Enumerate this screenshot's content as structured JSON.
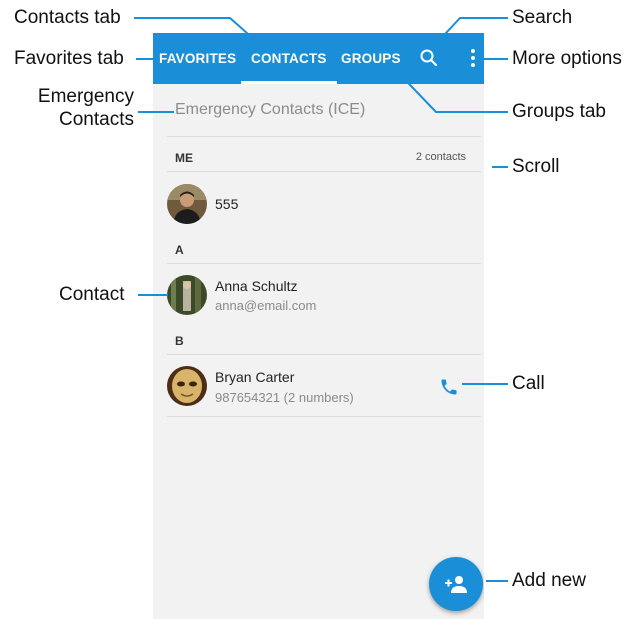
{
  "callouts": {
    "contacts_tab": "Contacts tab",
    "favorites_tab": "Favorites tab",
    "emergency_line1": "Emergency",
    "emergency_line2": "Contacts",
    "contact": "Contact",
    "search": "Search",
    "more_options": "More options",
    "groups_tab": "Groups tab",
    "scroll": "Scroll",
    "call": "Call",
    "add_new": "Add new"
  },
  "appbar": {
    "tabs": [
      "FAVORITES",
      "CONTACTS",
      "GROUPS"
    ],
    "active_tab": "CONTACTS",
    "icons": [
      "search-icon",
      "more-options-icon"
    ],
    "color": "#1a8fd8"
  },
  "ice": {
    "label": "Emergency Contacts (ICE)"
  },
  "sections": {
    "me": {
      "label": "ME",
      "count": "2 contacts"
    },
    "a": {
      "label": "A"
    },
    "b": {
      "label": "B"
    }
  },
  "contacts": [
    {
      "name": "555",
      "sub": ""
    },
    {
      "name": "Anna Schultz",
      "sub": "anna@email.com"
    },
    {
      "name": "Bryan Carter",
      "sub": "987654321 (2 numbers)"
    }
  ],
  "actions": {
    "call_icon": "phone-icon",
    "fab_icon": "add-person-icon"
  }
}
